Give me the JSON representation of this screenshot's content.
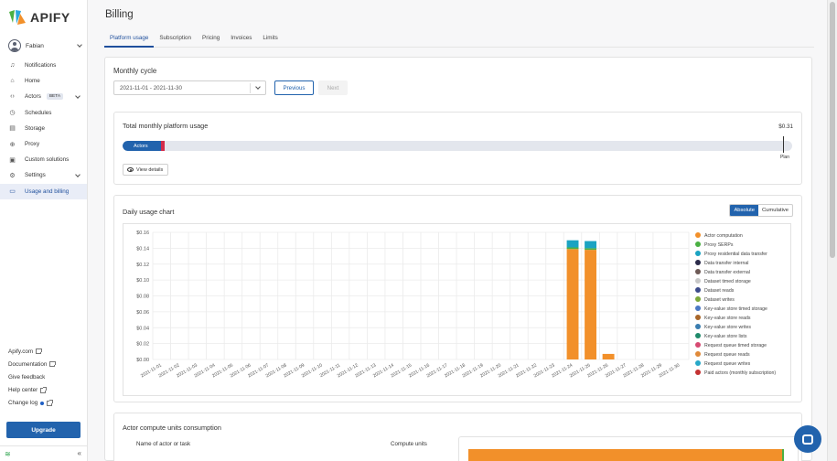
{
  "app": {
    "brand": "APIFY",
    "brand_colors": [
      "#f2902a",
      "#4bb043",
      "#2aa7db"
    ]
  },
  "user": {
    "name": "Fabian"
  },
  "sidebar": {
    "items": [
      {
        "label": "Notifications",
        "icon": "bell-icon"
      },
      {
        "label": "Home",
        "icon": "home-icon"
      },
      {
        "label": "Actors",
        "icon": "code-icon",
        "badge": "BETA",
        "expandable": true
      },
      {
        "label": "Schedules",
        "icon": "clock-icon"
      },
      {
        "label": "Storage",
        "icon": "storage-icon"
      },
      {
        "label": "Proxy",
        "icon": "globe-icon"
      },
      {
        "label": "Custom solutions",
        "icon": "briefcase-icon"
      },
      {
        "label": "Settings",
        "icon": "gear-icon",
        "expandable": true
      },
      {
        "label": "Usage and billing",
        "icon": "billing-icon",
        "active": true
      }
    ],
    "links": [
      {
        "label": "Apify.com",
        "external": true
      },
      {
        "label": "Documentation",
        "external": true
      },
      {
        "label": "Give feedback"
      },
      {
        "label": "Help center",
        "external": true
      },
      {
        "label": "Change log",
        "dot": true,
        "external": true
      }
    ],
    "upgrade_label": "Upgrade"
  },
  "header": {
    "title": "Billing"
  },
  "tabs": [
    {
      "label": "Platform usage",
      "active": true
    },
    {
      "label": "Subscription"
    },
    {
      "label": "Pricing"
    },
    {
      "label": "Invoices"
    },
    {
      "label": "Limits"
    }
  ],
  "monthly_cycle": {
    "title": "Monthly cycle",
    "selected": "2021-11-01 - 2021-11-30",
    "previous_label": "Previous",
    "next_label": "Next"
  },
  "total_usage": {
    "title": "Total monthly platform usage",
    "amount": "$0.31",
    "bar_label": "Actors",
    "actors_fraction": 0.058,
    "red_fraction": 0.005,
    "plan_label": "Plan",
    "view_details_label": "View details"
  },
  "daily_chart": {
    "title": "Daily usage chart",
    "mode_absolute": "Absolute",
    "mode_cumulative": "Cumulative"
  },
  "chart_data": {
    "type": "bar",
    "stacked": true,
    "y_ticks": [
      "$0.16",
      "$0.14",
      "$0.12",
      "$0.10",
      "$0.08",
      "$0.06",
      "$0.04",
      "$0.02",
      "$0.00"
    ],
    "ylim": [
      0,
      0.16
    ],
    "grid": true,
    "legend_position": "right",
    "categories": [
      "2021-11-01",
      "2021-11-02",
      "2021-11-03",
      "2021-11-04",
      "2021-11-05",
      "2021-11-06",
      "2021-11-07",
      "2021-11-08",
      "2021-11-09",
      "2021-11-10",
      "2021-11-11",
      "2021-11-12",
      "2021-11-13",
      "2021-11-14",
      "2021-11-15",
      "2021-11-16",
      "2021-11-17",
      "2021-11-18",
      "2021-11-19",
      "2021-11-20",
      "2021-11-21",
      "2021-11-22",
      "2021-11-23",
      "2021-11-24",
      "2021-11-25",
      "2021-11-26",
      "2021-11-27",
      "2021-11-28",
      "2021-11-29",
      "2021-11-30"
    ],
    "series": [
      {
        "name": "Actor computation",
        "color": "#f2902a",
        "values": [
          0,
          0,
          0,
          0,
          0,
          0,
          0,
          0,
          0,
          0,
          0,
          0,
          0,
          0,
          0,
          0,
          0,
          0,
          0,
          0,
          0,
          0,
          0,
          0.139,
          0.138,
          0.007,
          0,
          0,
          0,
          0
        ]
      },
      {
        "name": "Proxy SERPs",
        "color": "#4bb043",
        "values": [
          0,
          0,
          0,
          0,
          0,
          0,
          0,
          0,
          0,
          0,
          0,
          0,
          0,
          0,
          0,
          0,
          0,
          0,
          0,
          0,
          0,
          0,
          0,
          0.002,
          0.002,
          0,
          0,
          0,
          0,
          0
        ]
      },
      {
        "name": "Proxy residential data transfer",
        "color": "#1aa3c2",
        "values": [
          0,
          0,
          0,
          0,
          0,
          0,
          0,
          0,
          0,
          0,
          0,
          0,
          0,
          0,
          0,
          0,
          0,
          0,
          0,
          0,
          0,
          0,
          0,
          0.009,
          0.009,
          0,
          0,
          0,
          0,
          0
        ]
      },
      {
        "name": "Data transfer internal",
        "color": "#2b2b4a",
        "values": []
      },
      {
        "name": "Data transfer external",
        "color": "#6e5a56",
        "values": []
      },
      {
        "name": "Dataset timed storage",
        "color": "#c8c8c8",
        "values": []
      },
      {
        "name": "Dataset reads",
        "color": "#3c4b8a",
        "values": []
      },
      {
        "name": "Dataset writes",
        "color": "#7ca83a",
        "values": []
      },
      {
        "name": "Key-value store timed storage",
        "color": "#4a78c4",
        "values": []
      },
      {
        "name": "Key-value store reads",
        "color": "#a8662a",
        "values": []
      },
      {
        "name": "Key-value store writes",
        "color": "#3a7db0",
        "values": []
      },
      {
        "name": "Key-value store lists",
        "color": "#1f8a6a",
        "values": []
      },
      {
        "name": "Request queue timed storage",
        "color": "#d64a72",
        "values": []
      },
      {
        "name": "Request queue reads",
        "color": "#e08a3a",
        "values": []
      },
      {
        "name": "Request queue writes",
        "color": "#28a8c8",
        "values": []
      },
      {
        "name": "Paid actors (monthly subscription)",
        "color": "#c43232",
        "values": []
      }
    ]
  },
  "compute_units": {
    "title": "Actor compute units consumption",
    "col_name": "Name of actor or task",
    "col_units": "Compute units"
  }
}
